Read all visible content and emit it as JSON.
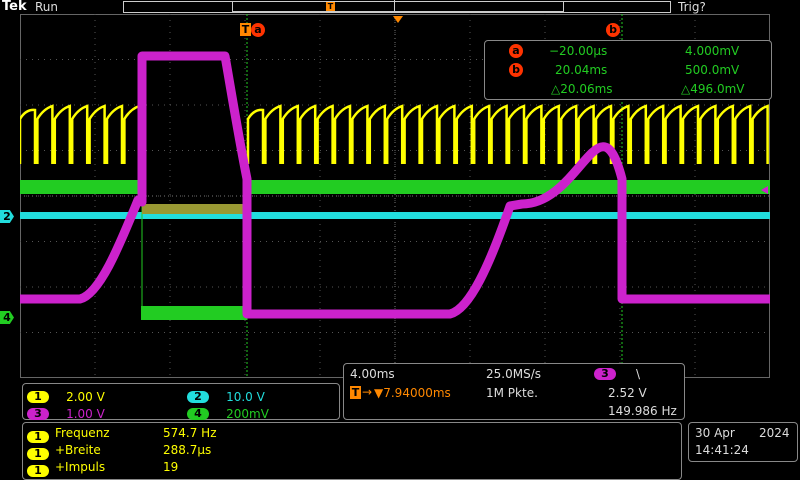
{
  "header": {
    "brand": "Tek",
    "state": "Run",
    "trigger_status": "Trig?"
  },
  "cursors": {
    "a_label": "a",
    "b_label": "b",
    "trigger_label": "T"
  },
  "cursor_readout": {
    "a": {
      "time": "−20.00µs",
      "value": "4.000mV"
    },
    "b": {
      "time": "20.04ms",
      "value": "500.0mV"
    },
    "delta": {
      "time": "△20.06ms",
      "value": "△496.0mV"
    }
  },
  "markers": {
    "ch2": "2",
    "ch4": "4"
  },
  "channels": [
    {
      "num": "1",
      "scale": "2.00 V",
      "color": "#ffff00"
    },
    {
      "num": "2",
      "scale": "10.0 V",
      "color": "#22dddd"
    },
    {
      "num": "3",
      "scale": "1.00 V",
      "color": "#cc22cc"
    },
    {
      "num": "4",
      "scale": "200mV",
      "color": "#22cc22"
    }
  ],
  "horizontal": {
    "time_div": "4.00ms",
    "sample_rate": "25.0MS/s",
    "trigger_source": "3",
    "trigger_slope": "\\",
    "trigger_pos": "▼7.94000ms",
    "record_length": "1M Pkte.",
    "trigger_level": "2.52 V",
    "trigger_freq": "149.986 Hz"
  },
  "measurements": [
    {
      "ch": "1",
      "name": "Frequenz",
      "value": "574.7 Hz"
    },
    {
      "ch": "1",
      "name": "+Breite",
      "value": "288.7µs"
    },
    {
      "ch": "1",
      "name": "+Impuls",
      "value": "19"
    }
  ],
  "datetime": {
    "date": "30 Apr",
    "year": "2024",
    "time": "14:41:24"
  }
}
